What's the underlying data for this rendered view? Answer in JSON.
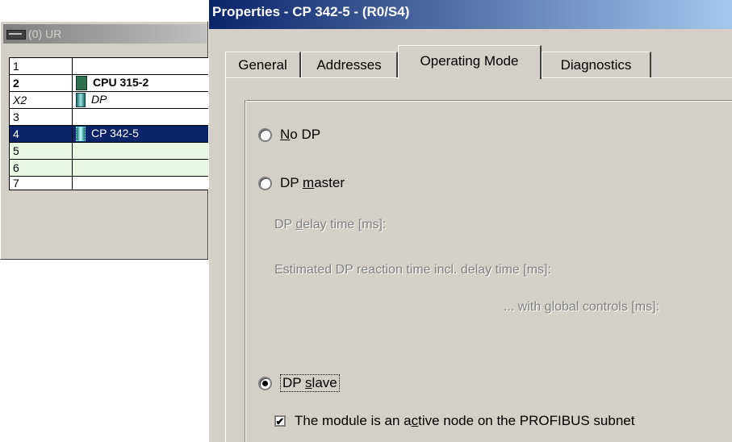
{
  "rack": {
    "title": "(0) UR",
    "rows": [
      {
        "slot": "1",
        "module": "",
        "style": "normal",
        "icon": ""
      },
      {
        "slot": "2",
        "module": "CPU 315-2",
        "style": "bold",
        "icon": "cpu-module-icon"
      },
      {
        "slot": "X2",
        "module": "DP",
        "style": "italic",
        "icon": "dp-interface-icon"
      },
      {
        "slot": "3",
        "module": "",
        "style": "normal",
        "icon": ""
      },
      {
        "slot": "4",
        "module": "CP 342-5",
        "style": "selected",
        "icon": "cp-module-icon"
      },
      {
        "slot": "5",
        "module": "",
        "style": "empty",
        "icon": ""
      },
      {
        "slot": "6",
        "module": "",
        "style": "empty",
        "icon": ""
      },
      {
        "slot": "7",
        "module": "",
        "style": "cut",
        "icon": ""
      }
    ]
  },
  "dialog": {
    "title": "Properties - CP 342-5 - (R0/S4)",
    "tabs": [
      "General",
      "Addresses",
      "Operating Mode",
      "Diagnostics"
    ],
    "active_tab": "Operating Mode",
    "options": {
      "no_dp": {
        "pre": "",
        "u": "N",
        "post": "o DP",
        "selected": false
      },
      "dp_master": {
        "pre": "DP ",
        "u": "m",
        "post": "aster",
        "selected": false
      },
      "dp_slave": {
        "pre": "DP ",
        "u": "s",
        "post": "lave",
        "selected": true
      }
    },
    "master_fields": {
      "delay_pre": "DP ",
      "delay_u": "d",
      "delay_post": "elay time [ms]:",
      "reaction": "Estimated DP reaction time incl. delay time [ms]:",
      "global": "... with global controls [ms]:"
    },
    "active_node": {
      "pre": "The module is an a",
      "u": "c",
      "post": "tive node on the PROFIBUS subnet",
      "checked": true
    }
  },
  "colors": {
    "selection": "#0a246a",
    "title_start": "#0a246a",
    "title_end": "#a6caf0",
    "empty_slot": "#e8f8e0"
  }
}
